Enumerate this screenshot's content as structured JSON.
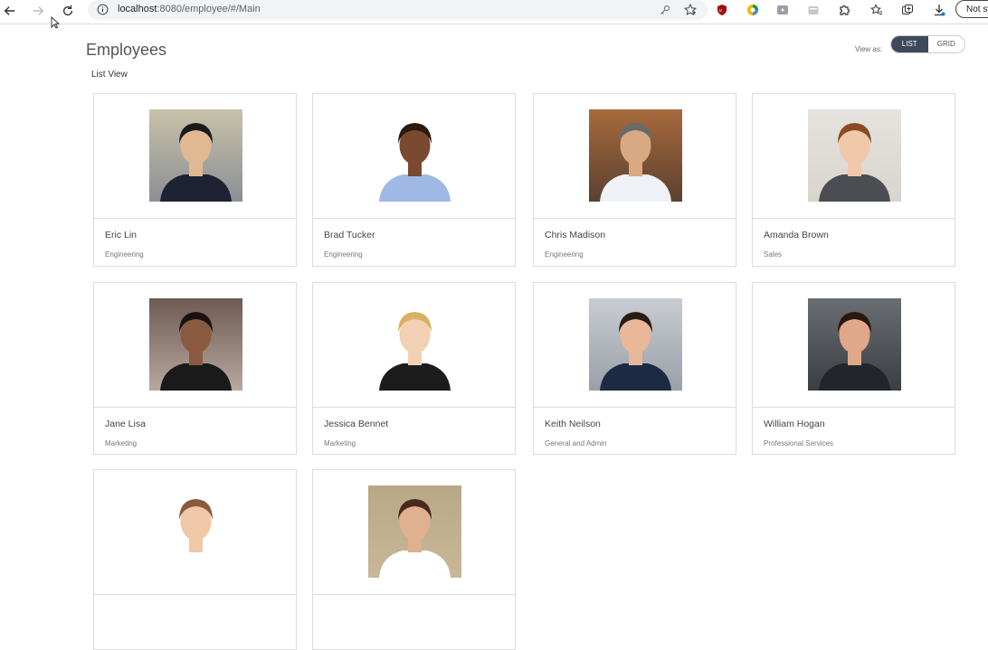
{
  "browser": {
    "url_host": "localhost",
    "url_rest": ":8080/employee/#/Main",
    "profile_label": "Not sy"
  },
  "page": {
    "title": "Employees",
    "subtitle": "List View",
    "view_as_label": "View as:",
    "view_options": [
      "LIST",
      "GRID"
    ],
    "selected_view": "LIST"
  },
  "employees": [
    {
      "name": "Eric Lin",
      "department": "Engineering",
      "bg": "#c8c2a8",
      "skin": "#e0b892",
      "hair": "#1a1a1a",
      "shirt": "#1e2233",
      "photo_bg2": "#8b8f96"
    },
    {
      "name": "Brad Tucker",
      "department": "Engineering",
      "bg": "#ffffff",
      "skin": "#7a4a30",
      "hair": "#2a1a10",
      "shirt": "#9fb8e6",
      "photo_bg2": "#ffffff"
    },
    {
      "name": "Chris Madison",
      "department": "Engineering",
      "bg": "#a86a3c",
      "skin": "#d9a984",
      "hair": "#6a6a6a",
      "shirt": "#eef1f6",
      "photo_bg2": "#5a4030"
    },
    {
      "name": "Amanda Brown",
      "department": "Sales",
      "bg": "#e6e3de",
      "skin": "#f0c8aa",
      "hair": "#8a4a22",
      "shirt": "#4a4e52",
      "photo_bg2": "#d8d4ce"
    },
    {
      "name": "Jane Lisa",
      "department": "Marketing",
      "bg": "#6e5a52",
      "skin": "#8a5a40",
      "hair": "#1a1210",
      "shirt": "#1a1a1a",
      "photo_bg2": "#b8a8a0"
    },
    {
      "name": "Jessica Bennet",
      "department": "Marketing",
      "bg": "#ffffff",
      "skin": "#f2d0b4",
      "hair": "#d9b060",
      "shirt": "#1c1c1c",
      "photo_bg2": "#ffffff"
    },
    {
      "name": "Keith Neilson",
      "department": "General and Admin",
      "bg": "#c8ccd2",
      "skin": "#e8b898",
      "hair": "#2a1c12",
      "shirt": "#1c2a44",
      "photo_bg2": "#9aa0a8"
    },
    {
      "name": "William Hogan",
      "department": "Professional Services",
      "bg": "#6a6e72",
      "skin": "#e0a888",
      "hair": "#2a1810",
      "shirt": "#22262c",
      "photo_bg2": "#3a3e42"
    },
    {
      "name": "",
      "department": "",
      "bg": "#ffffff",
      "skin": "#f0c8a8",
      "hair": "#8a5a3a",
      "shirt": "#ffffff",
      "photo_bg2": "#ffffff"
    },
    {
      "name": "",
      "department": "",
      "bg": "#b8a888",
      "skin": "#e0b090",
      "hair": "#4a2a1a",
      "shirt": "#ffffff",
      "photo_bg2": "#c8b898"
    }
  ]
}
